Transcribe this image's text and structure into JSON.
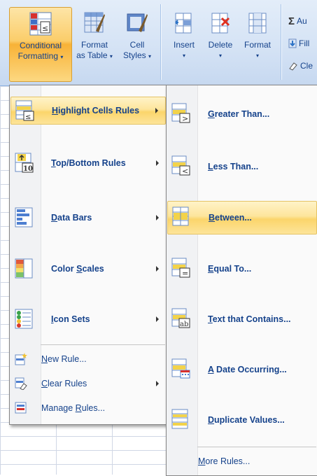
{
  "ribbon": {
    "conditional_formatting": {
      "line1": "Conditional",
      "line2": "Formatting"
    },
    "format_as_table": {
      "line1": "Format",
      "line2": "as Table"
    },
    "cell_styles": {
      "line1": "Cell",
      "line2": "Styles"
    },
    "insert": {
      "label": "Insert"
    },
    "delete": {
      "label": "Delete"
    },
    "format": {
      "label": "Format"
    },
    "autosum": {
      "label": "Au"
    },
    "fill": {
      "label": "Fill"
    },
    "clear": {
      "label": "Cle"
    }
  },
  "main_menu": {
    "items": [
      {
        "label": "Highlight Cells Rules",
        "accel": "H",
        "rest": "ighlight Cells Rules",
        "submenu": true
      },
      {
        "label": "Top/Bottom Rules",
        "accel": "T",
        "rest": "op/Bottom Rules",
        "submenu": true
      },
      {
        "label": "Data Bars",
        "accel": "D",
        "rest": "ata Bars",
        "submenu": true
      },
      {
        "label": "Color Scales",
        "pre": "Color ",
        "accel": "S",
        "rest": "cales",
        "submenu": true
      },
      {
        "label": "Icon Sets",
        "accel": "I",
        "rest": "con Sets",
        "submenu": true
      }
    ],
    "small_items": [
      {
        "accel": "N",
        "rest": "ew Rule...",
        "submenu": false
      },
      {
        "accel": "C",
        "rest": "lear Rules",
        "submenu": true
      },
      {
        "pre": "Manage ",
        "accel": "R",
        "rest": "ules...",
        "submenu": false
      }
    ]
  },
  "sub_menu": {
    "items": [
      {
        "accel": "G",
        "rest": "reater Than..."
      },
      {
        "accel": "L",
        "rest": "ess Than..."
      },
      {
        "accel": "B",
        "rest": "etween..."
      },
      {
        "accel": "E",
        "rest": "qual To..."
      },
      {
        "accel": "T",
        "rest": "ext that Contains..."
      },
      {
        "accel": "A",
        "rest": " Date Occurring..."
      },
      {
        "accel": "D",
        "rest": "uplicate Values..."
      }
    ],
    "more": {
      "accel": "M",
      "rest": "ore Rules..."
    }
  }
}
